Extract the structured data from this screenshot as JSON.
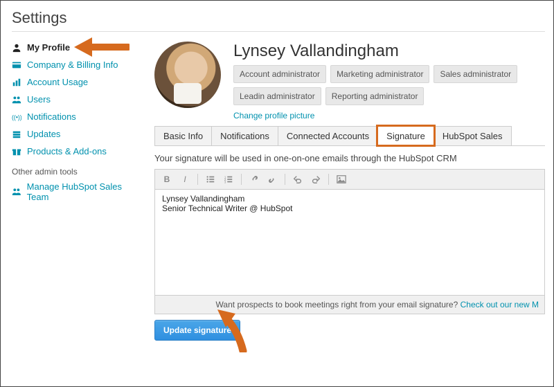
{
  "page": {
    "title": "Settings"
  },
  "sidebar": {
    "items": [
      {
        "label": "My Profile",
        "icon": "user",
        "active": true
      },
      {
        "label": "Company & Billing Info",
        "icon": "card"
      },
      {
        "label": "Account Usage",
        "icon": "bars"
      },
      {
        "label": "Users",
        "icon": "people"
      },
      {
        "label": "Notifications",
        "icon": "signals"
      },
      {
        "label": "Updates",
        "icon": "stack"
      },
      {
        "label": "Products & Add-ons",
        "icon": "gift"
      }
    ],
    "other_heading": "Other admin tools",
    "other_items": [
      {
        "label": "Manage HubSpot Sales Team",
        "icon": "people"
      }
    ]
  },
  "profile": {
    "name": "Lynsey Vallandingham",
    "roles": [
      "Account administrator",
      "Marketing administrator",
      "Sales administrator",
      "Leadin administrator",
      "Reporting administrator"
    ],
    "change_picture_label": "Change profile picture"
  },
  "tabs": [
    {
      "label": "Basic Info"
    },
    {
      "label": "Notifications"
    },
    {
      "label": "Connected Accounts"
    },
    {
      "label": "Signature",
      "active": true,
      "highlight": true
    },
    {
      "label": "HubSpot Sales"
    }
  ],
  "signature": {
    "description": "Your signature will be used in one-on-one emails through the HubSpot CRM",
    "content": "Lynsey Vallandingham\nSenior Technical Writer @ HubSpot",
    "footer_lead": "Want prospects to book meetings right from your email signature? ",
    "footer_link": "Check out our new M",
    "update_button": "Update signature"
  },
  "annotations": {
    "arrow1": "arrow pointing to My Profile",
    "arrow2": "arrow pointing to Update signature",
    "signature_highlight_color": "#d66a1e"
  }
}
